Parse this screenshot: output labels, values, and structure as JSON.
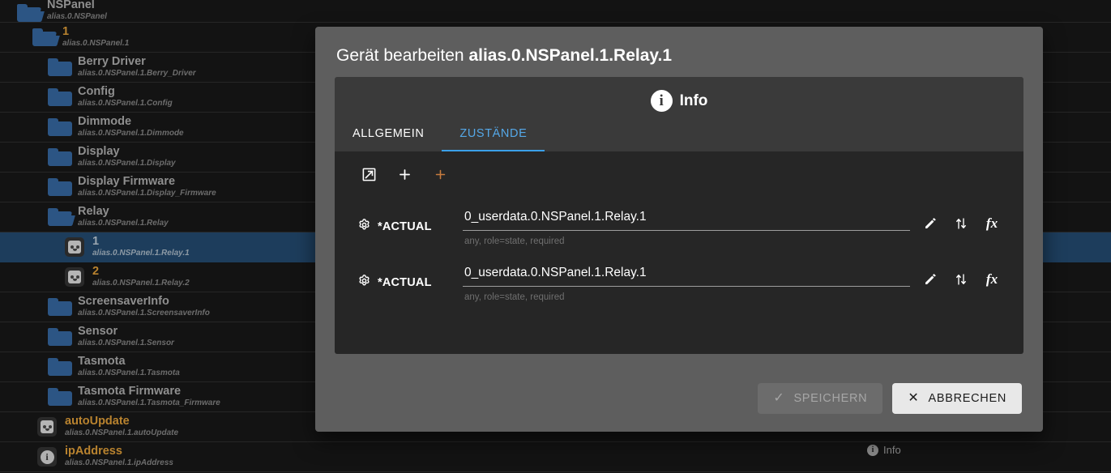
{
  "tree": {
    "items": [
      {
        "name": "NSPanel",
        "id": "alias.0.NSPanel",
        "icon": "folder-open-icon",
        "indent": 14,
        "accent": false,
        "selected": false,
        "partial_top": true
      },
      {
        "name": "1",
        "id": "alias.0.NSPanel.1",
        "icon": "folder-open-icon",
        "indent": 33,
        "accent": true,
        "selected": false
      },
      {
        "name": "Berry Driver",
        "id": "alias.0.NSPanel.1.Berry_Driver",
        "icon": "folder-icon",
        "indent": 52,
        "accent": false,
        "selected": false
      },
      {
        "name": "Config",
        "id": "alias.0.NSPanel.1.Config",
        "icon": "folder-icon",
        "indent": 52,
        "accent": false,
        "selected": false
      },
      {
        "name": "Dimmode",
        "id": "alias.0.NSPanel.1.Dimmode",
        "icon": "folder-icon",
        "indent": 52,
        "accent": false,
        "selected": false
      },
      {
        "name": "Display",
        "id": "alias.0.NSPanel.1.Display",
        "icon": "folder-icon",
        "indent": 52,
        "accent": false,
        "selected": false
      },
      {
        "name": "Display Firmware",
        "id": "alias.0.NSPanel.1.Display_Firmware",
        "icon": "folder-icon",
        "indent": 52,
        "accent": false,
        "selected": false
      },
      {
        "name": "Relay",
        "id": "alias.0.NSPanel.1.Relay",
        "icon": "folder-open-icon",
        "indent": 52,
        "accent": false,
        "selected": false
      },
      {
        "name": "1",
        "id": "alias.0.NSPanel.1.Relay.1",
        "icon": "socket-icon",
        "indent": 70,
        "accent": false,
        "selected": true
      },
      {
        "name": "2",
        "id": "alias.0.NSPanel.1.Relay.2",
        "icon": "socket-icon",
        "indent": 70,
        "accent": true,
        "selected": false
      },
      {
        "name": "ScreensaverInfo",
        "id": "alias.0.NSPanel.1.ScreensaverInfo",
        "icon": "folder-icon",
        "indent": 52,
        "accent": false,
        "selected": false
      },
      {
        "name": "Sensor",
        "id": "alias.0.NSPanel.1.Sensor",
        "icon": "folder-icon",
        "indent": 52,
        "accent": false,
        "selected": false
      },
      {
        "name": "Tasmota",
        "id": "alias.0.NSPanel.1.Tasmota",
        "icon": "folder-icon",
        "indent": 52,
        "accent": false,
        "selected": false
      },
      {
        "name": "Tasmota Firmware",
        "id": "alias.0.NSPanel.1.Tasmota_Firmware",
        "icon": "folder-icon",
        "indent": 52,
        "accent": false,
        "selected": false
      },
      {
        "name": "autoUpdate",
        "id": "alias.0.NSPanel.1.autoUpdate",
        "icon": "socket-icon",
        "indent": 36,
        "accent": true,
        "selected": false
      },
      {
        "name": "ipAddress",
        "id": "alias.0.NSPanel.1.ipAddress",
        "icon": "info-icon",
        "indent": 36,
        "accent": true,
        "selected": false
      }
    ],
    "background_info_label": "Info"
  },
  "dialog": {
    "title_prefix": "Gerät bearbeiten",
    "title_object": "alias.0.NSPanel.1.Relay.1",
    "info_header": "Info",
    "tabs": [
      {
        "label": "ALLGEMEIN",
        "active": false
      },
      {
        "label": "ZUSTÄNDE",
        "active": true
      }
    ],
    "toolbar": [
      {
        "name": "expand-all-icon",
        "label": "expand"
      },
      {
        "name": "add-state-icon",
        "label": "+"
      },
      {
        "name": "add-custom-state-icon",
        "label": "+"
      }
    ],
    "states": [
      {
        "label": "*ACTUAL",
        "value": "0_userdata.0.NSPanel.1.Relay.1",
        "hint": "any, role=state, required",
        "actions": [
          "edit-icon",
          "swap-vert-icon",
          "function-icon"
        ]
      },
      {
        "label": "*ACTUAL",
        "value": "0_userdata.0.NSPanel.1.Relay.1",
        "hint": "any, role=state, required",
        "actions": [
          "edit-icon",
          "swap-vert-icon",
          "function-icon"
        ]
      }
    ],
    "buttons": {
      "save": "SPEICHERN",
      "cancel": "ABBRECHEN"
    },
    "colors": {
      "accent_blue": "#3ba0e8",
      "selection_blue": "#1d3d5c",
      "folder_blue": "#2c5584",
      "tree_accent": "#b9832f",
      "dialog_bg": "#5e5e5e",
      "card_bg": "#3a3a3a",
      "content_bg": "#262626",
      "add_custom_orange": "#c77b3e"
    }
  }
}
